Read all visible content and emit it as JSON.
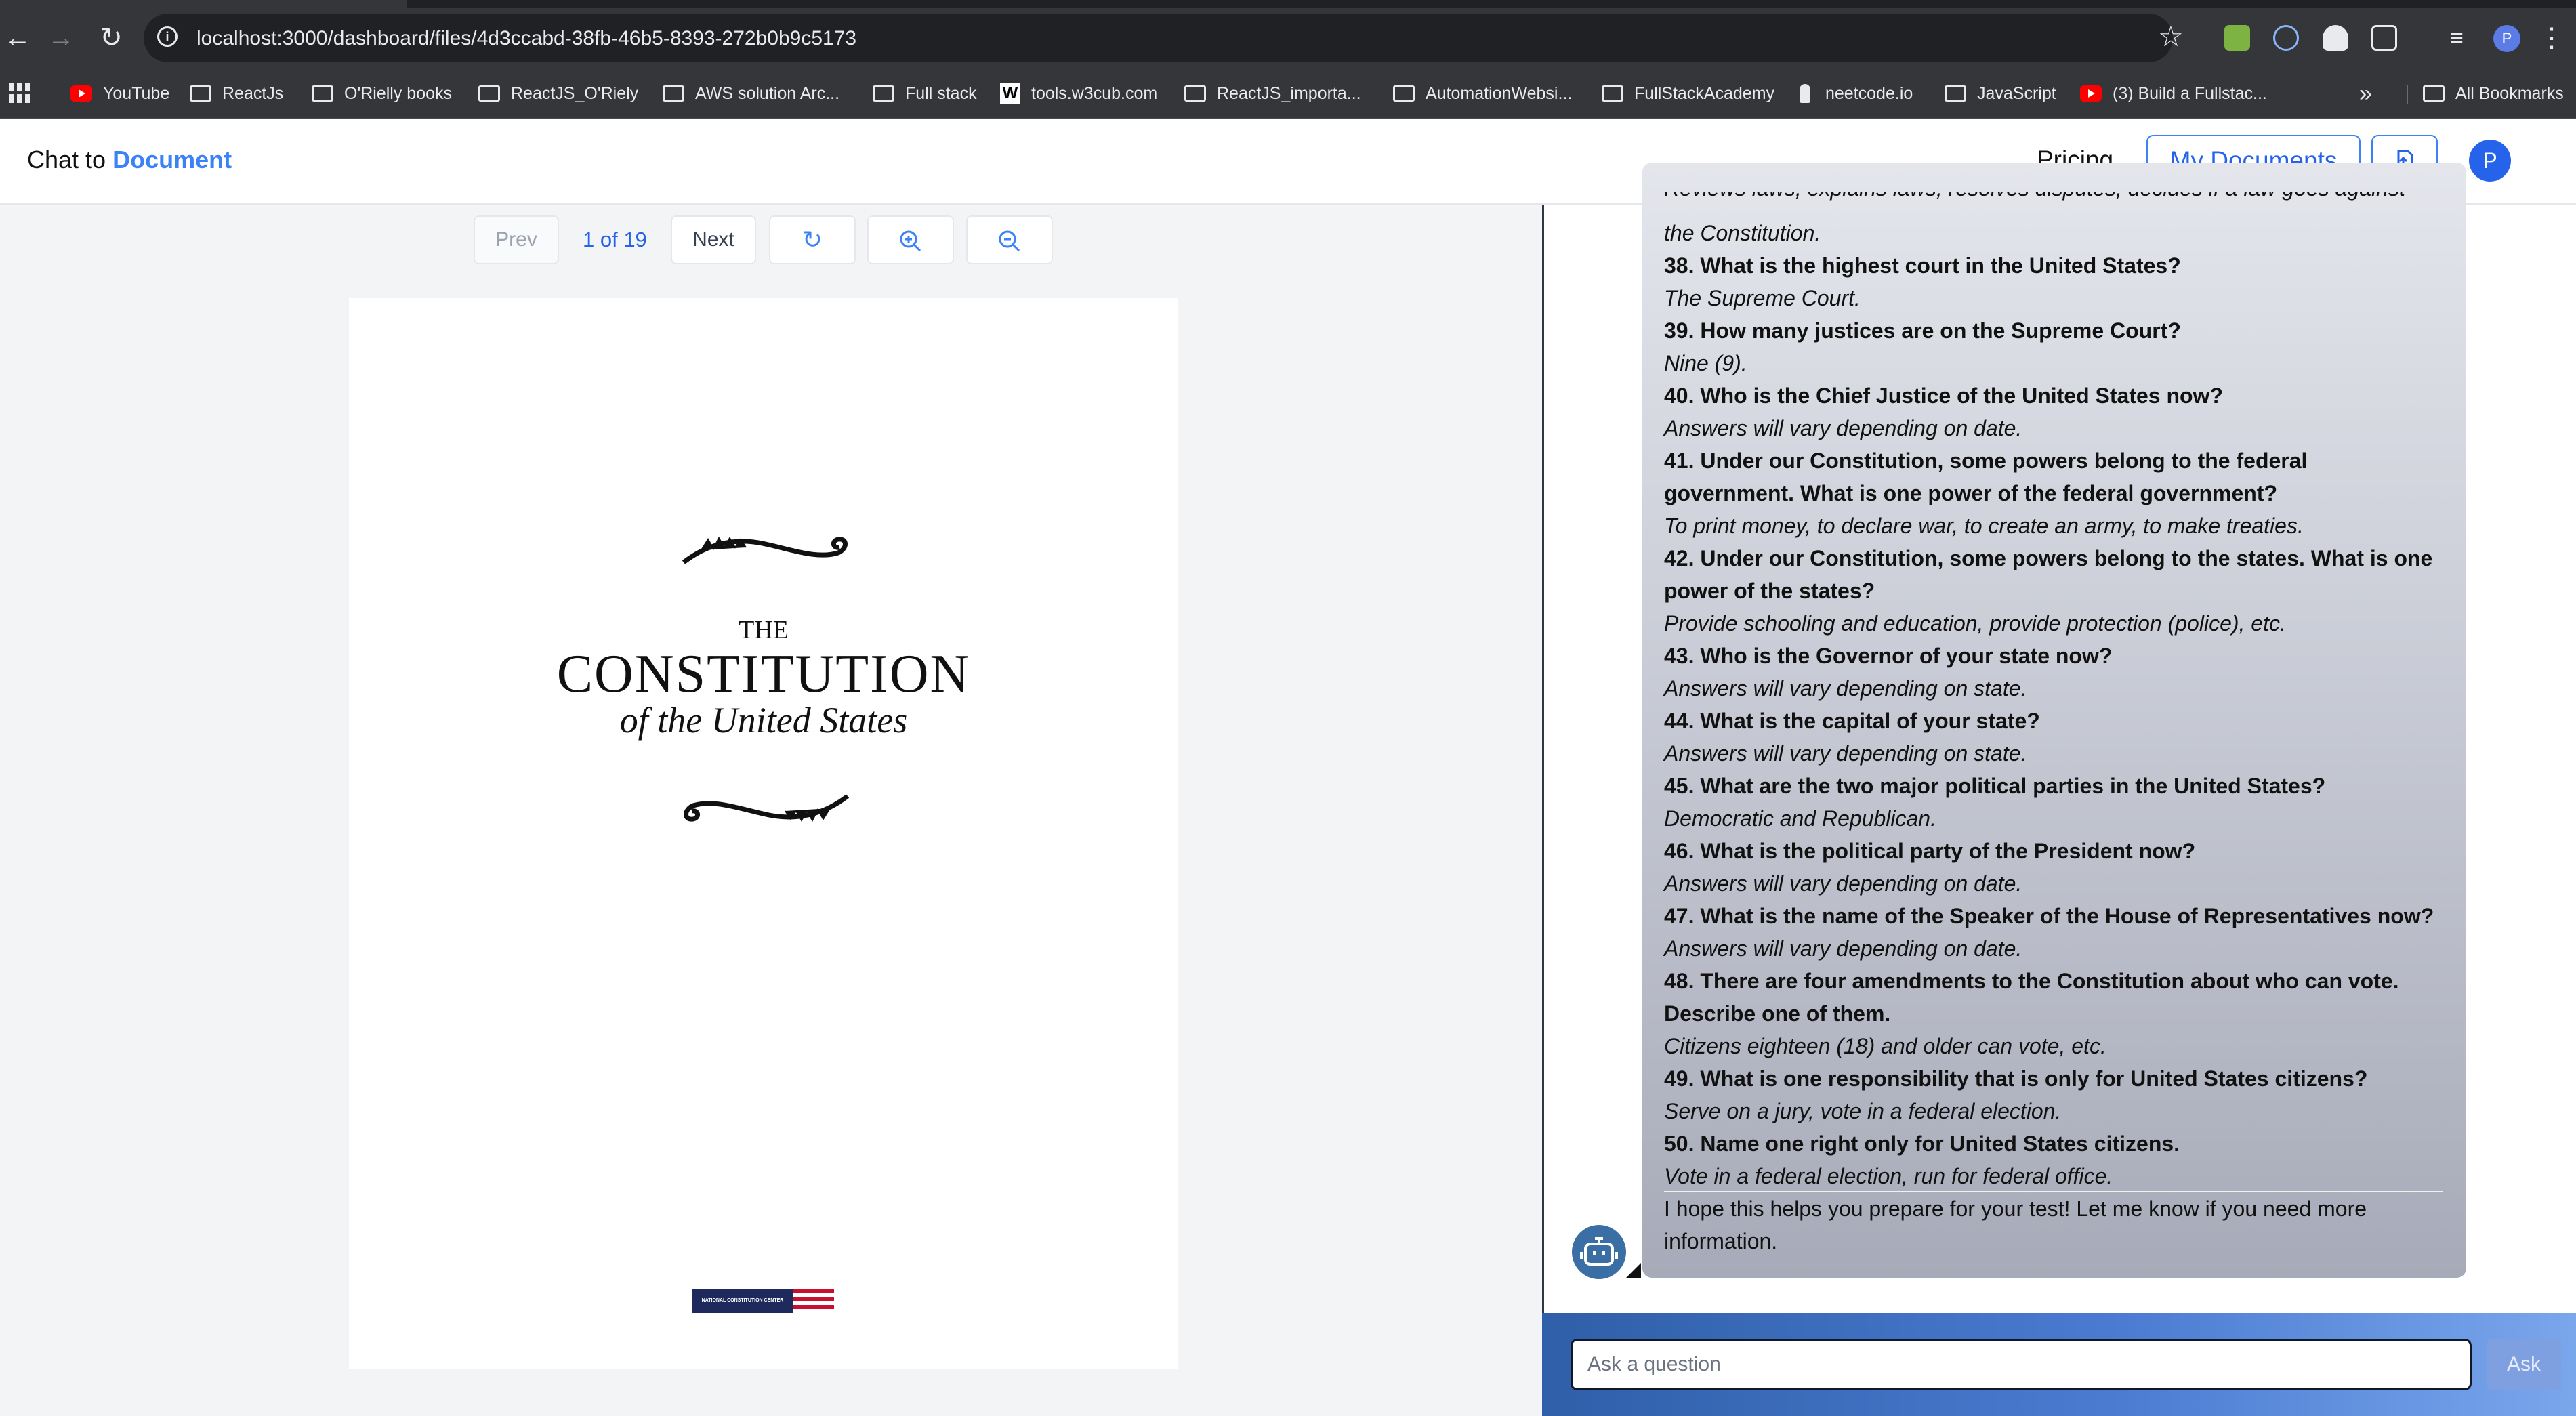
{
  "browser": {
    "url": "localhost:3000/dashboard/files/4d3ccabd-38fb-46b5-8393-272b0b9c5173",
    "profile_initial": "P",
    "bookmarks": [
      {
        "label": "YouTube",
        "icon": "youtube-icon"
      },
      {
        "label": "ReactJs",
        "icon": "folder-icon"
      },
      {
        "label": "O'Rielly books",
        "icon": "folder-icon"
      },
      {
        "label": "ReactJS_O'Riely",
        "icon": "folder-icon"
      },
      {
        "label": "AWS solution Arc...",
        "icon": "folder-icon"
      },
      {
        "label": "Full stack",
        "icon": "folder-icon"
      },
      {
        "label": "tools.w3cub.com",
        "icon": "w3cub-icon"
      },
      {
        "label": "ReactJS_importa...",
        "icon": "folder-icon"
      },
      {
        "label": "AutomationWebsi...",
        "icon": "folder-icon"
      },
      {
        "label": "FullStackAcademy",
        "icon": "folder-icon"
      },
      {
        "label": "neetcode.io",
        "icon": "neetcode-icon"
      },
      {
        "label": "JavaScript",
        "icon": "folder-icon"
      },
      {
        "label": "(3) Build a Fullstac...",
        "icon": "youtube-icon"
      }
    ],
    "all_bookmarks": "All Bookmarks"
  },
  "app": {
    "brand_prefix": "Chat to",
    "brand_highlight": "Document",
    "pricing": "Pricing",
    "my_documents": "My Documents",
    "user_initial": "P"
  },
  "viewer": {
    "prev": "Prev",
    "page_indicator": "1 of 19",
    "next": "Next",
    "doc": {
      "the": "THE",
      "title": "CONSTITUTION",
      "subtitle": "of the United States",
      "footer_logo": "NATIONAL CONSTITUTION CENTER"
    }
  },
  "chat": {
    "message_lines": [
      {
        "text": "Reviews laws, explains laws, resolves disputes, decides if a law goes against",
        "style": "a"
      },
      {
        "text": "the Constitution.",
        "style": "a"
      },
      {
        "text": "38. What is the highest court in the United States?",
        "style": "q"
      },
      {
        "text": "The Supreme Court.",
        "style": "a"
      },
      {
        "text": "39. How many justices are on the Supreme Court?",
        "style": "q"
      },
      {
        "text": "Nine (9).",
        "style": "a"
      },
      {
        "text": "40. Who is the Chief Justice of the United States now?",
        "style": "q"
      },
      {
        "text": "Answers will vary depending on date.",
        "style": "a"
      },
      {
        "text": "41. Under our Constitution, some powers belong to the federal",
        "style": "q"
      },
      {
        "text": "government. What is one power of the federal government?",
        "style": "q"
      },
      {
        "text": "To print money, to declare war, to create an army, to make treaties.",
        "style": "a"
      },
      {
        "text": "42. Under our Constitution, some powers belong to the states. What is one",
        "style": "q"
      },
      {
        "text": "power of the states?",
        "style": "q"
      },
      {
        "text": "Provide schooling and education, provide protection (police), etc.",
        "style": "a"
      },
      {
        "text": "43. Who is the Governor of your state now?",
        "style": "q"
      },
      {
        "text": "Answers will vary depending on state.",
        "style": "a"
      },
      {
        "text": "44. What is the capital of your state?",
        "style": "q"
      },
      {
        "text": "Answers will vary depending on state.",
        "style": "a"
      },
      {
        "text": "45. What are the two major political parties in the United States?",
        "style": "q"
      },
      {
        "text": "Democratic and Republican.",
        "style": "a"
      },
      {
        "text": "46. What is the political party of the President now?",
        "style": "q"
      },
      {
        "text": "Answers will vary depending on date.",
        "style": "a"
      },
      {
        "text": "47. What is the name of the Speaker of the House of Representatives now?",
        "style": "q"
      },
      {
        "text": "Answers will vary depending on date.",
        "style": "a"
      },
      {
        "text": "48. There are four amendments to the Constitution about who can vote.",
        "style": "q"
      },
      {
        "text": "Describe one of them.",
        "style": "q"
      },
      {
        "text": "Citizens eighteen (18) and older can vote, etc.",
        "style": "a"
      },
      {
        "text": "49. What is one responsibility that is only for United States citizens?",
        "style": "q"
      },
      {
        "text": "Serve on a jury, vote in a federal election.",
        "style": "a"
      },
      {
        "text": "50. Name one right only for United States citizens.",
        "style": "q"
      },
      {
        "text": "Vote in a federal election, run for federal office.",
        "style": "a"
      },
      {
        "text": "I hope this helps you prepare for your test! Let me know if you need more",
        "style": "n"
      },
      {
        "text": "information.",
        "style": "n"
      }
    ],
    "input_placeholder": "Ask a question",
    "ask": "Ask"
  }
}
